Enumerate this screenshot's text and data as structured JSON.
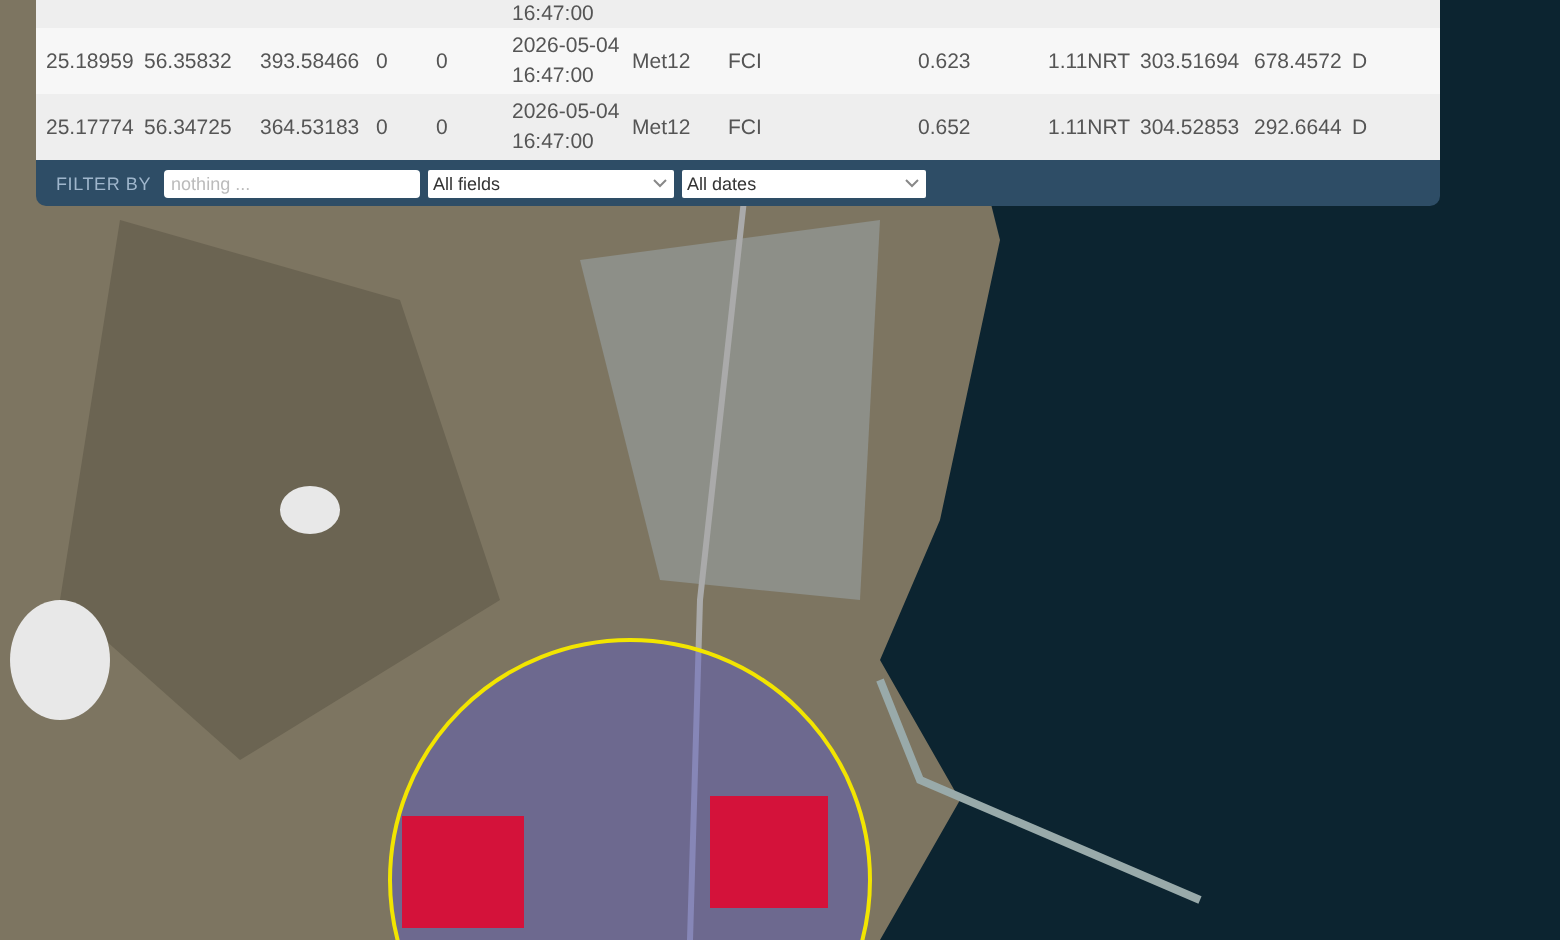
{
  "table": {
    "rows": [
      {
        "cells": [
          null,
          null,
          null,
          null,
          null,
          "16:47:00",
          null,
          null,
          null,
          null,
          null,
          null,
          null
        ]
      },
      {
        "cells": [
          "25.18959",
          "56.35832",
          "393.58466",
          "0",
          "0",
          "2026-05-04 16:47:00",
          "Met12",
          "FCI",
          "0.623",
          "1.11NRT",
          "303.51694",
          "678.4572",
          "D"
        ]
      },
      {
        "cells": [
          "25.17774",
          "56.34725",
          "364.53183",
          "0",
          "0",
          "2026-05-04 16:47:00",
          "Met12",
          "FCI",
          "0.652",
          "1.11NRT",
          "304.52853",
          "292.6644",
          "D"
        ]
      }
    ]
  },
  "filter_bar": {
    "label": "FILTER BY",
    "search": {
      "placeholder": "nothing ..."
    },
    "field_select": "All fields",
    "date_select": "All dates"
  }
}
